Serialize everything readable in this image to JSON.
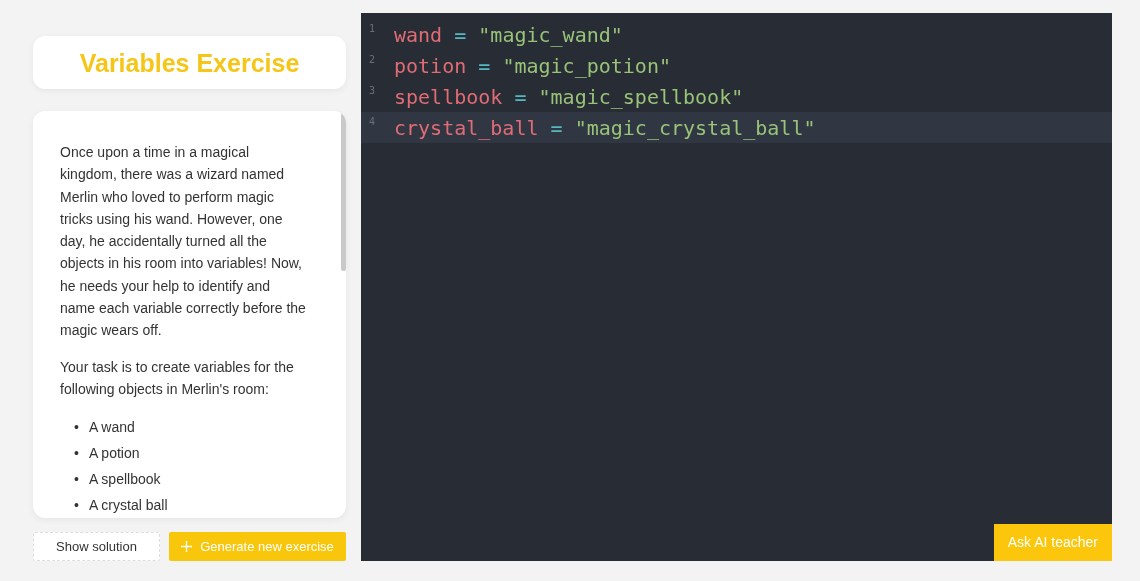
{
  "title": "Variables Exercise",
  "story": {
    "paragraphs": [
      "Once upon a time in a magical kingdom, there was a wizard named Merlin who loved to perform magic tricks using his wand. However, one day, he accidentally turned all the objects in his room into variables! Now, he needs your help to identify and name each variable correctly before the magic wears off.",
      "Your task is to create variables for the following objects in Merlin's room:"
    ],
    "bullet_marker": "•",
    "bullets": [
      "A wand",
      "A potion",
      "A spellbook",
      "A crystal ball"
    ]
  },
  "buttons": {
    "show_solution": "Show solution",
    "generate": "Generate new exercise"
  },
  "editor": {
    "lines": [
      {
        "number": "1",
        "active": false,
        "tokens": [
          {
            "kind": "variable",
            "text": "wand"
          },
          {
            "kind": "operator",
            "text": "="
          },
          {
            "kind": "string",
            "text": "\"magic_wand\""
          }
        ]
      },
      {
        "number": "2",
        "active": false,
        "tokens": [
          {
            "kind": "variable",
            "text": "potion"
          },
          {
            "kind": "operator",
            "text": "="
          },
          {
            "kind": "string",
            "text": "\"magic_potion\""
          }
        ]
      },
      {
        "number": "3",
        "active": false,
        "tokens": [
          {
            "kind": "variable",
            "text": "spellbook"
          },
          {
            "kind": "operator",
            "text": "="
          },
          {
            "kind": "string",
            "text": "\"magic_spellbook\""
          }
        ]
      },
      {
        "number": "4",
        "active": true,
        "tokens": [
          {
            "kind": "variable",
            "text": "crystal_ball"
          },
          {
            "kind": "operator",
            "text": "="
          },
          {
            "kind": "string",
            "text": "\"magic_crystal_ball\""
          }
        ]
      }
    ],
    "ask_button": "Ask AI teacher"
  }
}
